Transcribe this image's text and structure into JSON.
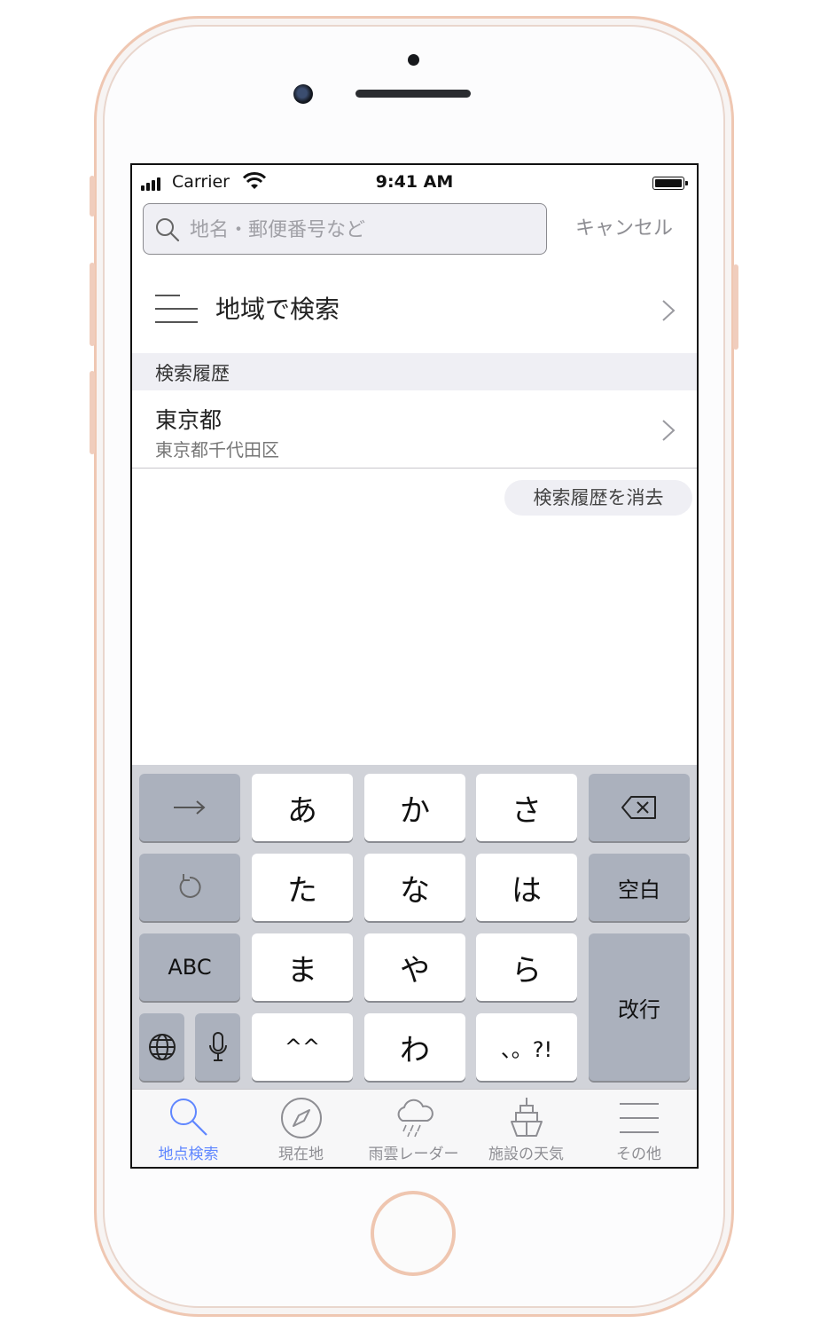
{
  "status_bar": {
    "carrier": "Carrier",
    "time": "9:41 AM"
  },
  "search": {
    "placeholder": "地名・郵便番号など",
    "value": "",
    "cancel_label": "キャンセル"
  },
  "region_search": {
    "label": "地域で検索"
  },
  "history": {
    "header": "検索履歴",
    "items": [
      {
        "title": "東京都",
        "subtitle": "東京都千代田区"
      }
    ],
    "clear_label": "検索履歴を消去"
  },
  "keyboard": {
    "keys": {
      "a": "あ",
      "ka": "か",
      "sa": "さ",
      "ta": "た",
      "na": "な",
      "ha": "は",
      "ma": "ま",
      "ya": "や",
      "ra": "ら",
      "dakuten": "^^",
      "wa": "わ",
      "punct": "、。?!",
      "abc": "ABC",
      "space": "空白",
      "return": "改行"
    }
  },
  "tabbar": {
    "tabs": [
      {
        "label": "地点検索",
        "icon": "search-icon",
        "active": true
      },
      {
        "label": "現在地",
        "icon": "compass-icon",
        "active": false
      },
      {
        "label": "雨雲レーダー",
        "icon": "rain-cloud-icon",
        "active": false
      },
      {
        "label": "施設の天気",
        "icon": "ship-icon",
        "active": false
      },
      {
        "label": "その他",
        "icon": "menu-icon",
        "active": false
      }
    ],
    "active_color": "#5f86ff",
    "inactive_color": "#8e8e93"
  }
}
